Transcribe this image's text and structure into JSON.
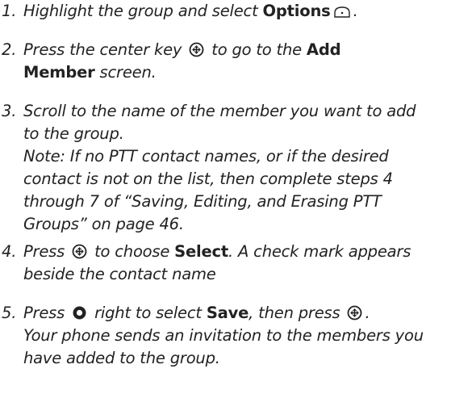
{
  "steps": [
    {
      "number": "1.",
      "lines": [
        {
          "pre": "Highlight the group and select ",
          "bold": "Options",
          "icon": "softkey-right-icon",
          "post": "."
        }
      ]
    },
    {
      "number": "2.",
      "lines": [
        {
          "pre": "Press the center key ",
          "icon": "center-key-icon",
          "post": " to go to the ",
          "bold": "Add"
        },
        {
          "bold": "Member",
          "post": " screen."
        }
      ]
    },
    {
      "number": "3.",
      "lines": [
        {
          "pre": "Scroll to the name of the member you want to add"
        },
        {
          "pre": "to the group."
        },
        {
          "pre": "Note: If no PTT contact names, or if the desired"
        },
        {
          "pre": "contact is not on the list, then complete steps 4"
        },
        {
          "pre": "through 7 of “Saving, Editing, and Erasing PTT"
        },
        {
          "pre": "Groups” on page 46."
        }
      ]
    },
    {
      "number": "4.",
      "lines": [
        {
          "pre": "Press ",
          "icon": "center-key-icon",
          "post": " to choose ",
          "bold": "Select",
          "post2": ". A check mark appears"
        },
        {
          "pre": "beside the contact name"
        }
      ]
    },
    {
      "number": "5.",
      "lines": [
        {
          "pre": "Press ",
          "icon": "nav-key-icon",
          "post": " right to select ",
          "bold": "Save",
          "post2": ", then press ",
          "icon2": "center-key-icon",
          "post3": "."
        },
        {
          "pre": "Your phone sends an invitation to the members you"
        },
        {
          "pre": "have added to the group."
        }
      ]
    }
  ]
}
